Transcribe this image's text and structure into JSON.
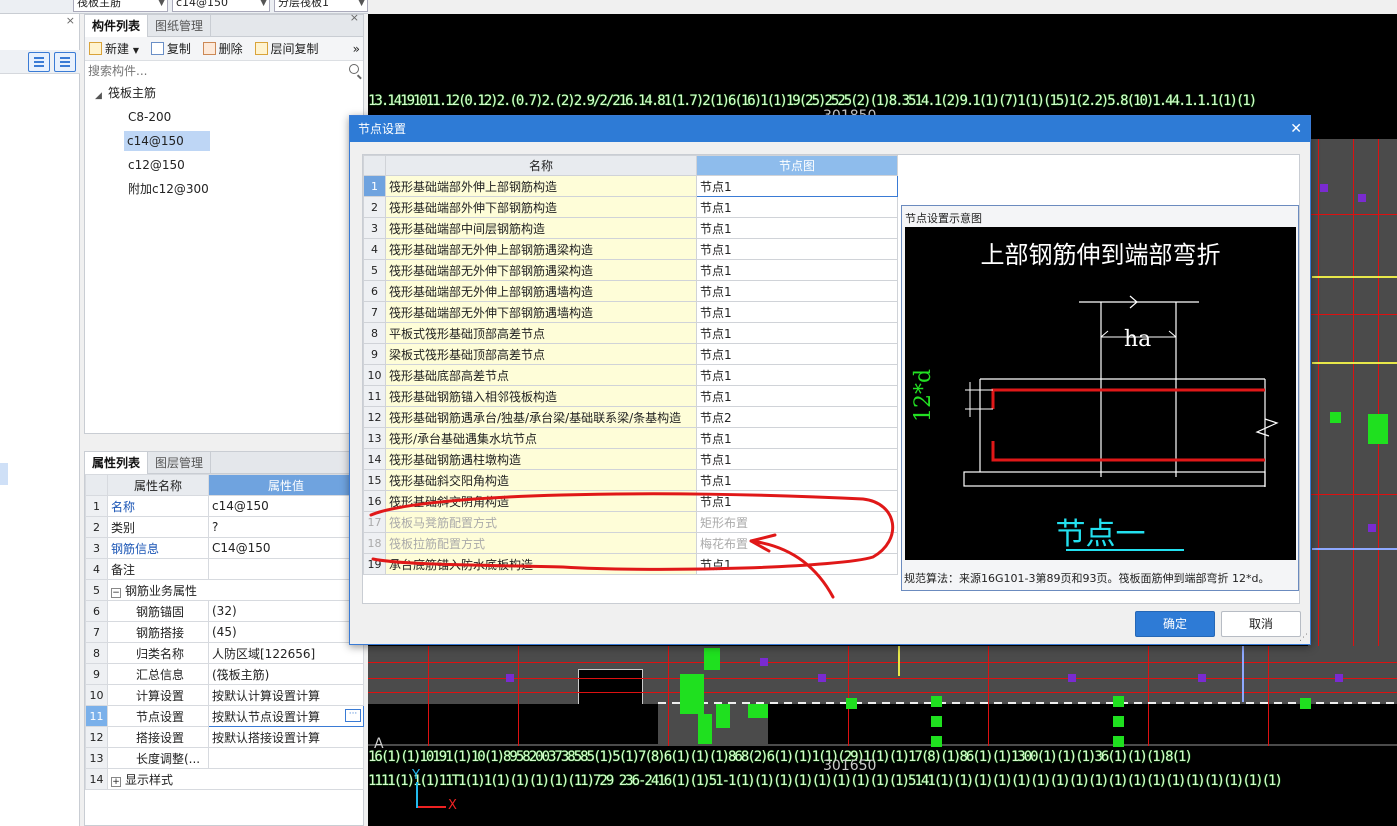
{
  "top_toolbar": {
    "combo1": "筏板主筋",
    "combo2": "c14@150",
    "combo3": "分层筏板1"
  },
  "component_panel": {
    "tabs": [
      "构件列表",
      "图纸管理"
    ],
    "toolbar": {
      "new_label": "新建",
      "copy_label": "复制",
      "delete_label": "删除",
      "floor_copy_label": "层间复制"
    },
    "search_placeholder": "搜索构件...",
    "tree": {
      "root": "筏板主筋",
      "items": [
        "C8-200",
        "c14@150",
        "c12@150",
        "附加c12@300"
      ]
    }
  },
  "property_panel": {
    "tabs": [
      "属性列表",
      "图层管理"
    ],
    "headers": {
      "name": "属性名称",
      "value": "属性值"
    },
    "rows": [
      {
        "num": "1",
        "name": "名称",
        "value": "c14@150"
      },
      {
        "num": "2",
        "name": "类别",
        "value": "?"
      },
      {
        "num": "3",
        "name": "钢筋信息",
        "value": "C14@150"
      },
      {
        "num": "4",
        "name": "备注",
        "value": ""
      },
      {
        "num": "5",
        "name": "钢筋业务属性",
        "value": ""
      },
      {
        "num": "6",
        "name": "钢筋锚固",
        "value": "(32)"
      },
      {
        "num": "7",
        "name": "钢筋搭接",
        "value": "(45)"
      },
      {
        "num": "8",
        "name": "归类名称",
        "value": "人防区域[122656]"
      },
      {
        "num": "9",
        "name": "汇总信息",
        "value": "(筏板主筋)"
      },
      {
        "num": "10",
        "name": "计算设置",
        "value": "按默认计算设置计算"
      },
      {
        "num": "11",
        "name": "节点设置",
        "value": "按默认节点设置计算"
      },
      {
        "num": "12",
        "name": "搭接设置",
        "value": "按默认搭接设置计算"
      },
      {
        "num": "13",
        "name": "长度调整(...",
        "value": ""
      },
      {
        "num": "14",
        "name": "显示样式",
        "value": ""
      }
    ],
    "expand_minus": "−",
    "expand_plus": "+"
  },
  "cad": {
    "label_top": "301850",
    "label_bottom": "301650",
    "label_a": "A",
    "axis_x": "X",
    "axis_y": "Y",
    "strip_top": "13.14191011.12(0.12)2.(0.7)2.(2)2.9/2/216.14.81(1.7)2(1)6(16)1(1)19(25)2525(2)(1)8.3514.1(2)9.1(1)(7)1(1)(15)1(2.2)5.8(10)1.44.1.1.1(1)(1)",
    "strip_bottom1": "16(1)(1)10191(1)10(1)89582003738585(1)5(1)7(8)6(1)(1)(1)868(2)6(1)(1)1(1)(29)1(1)(1)17(8)(1)86(1)(1)1300(1)(1)(1)36(1)(1)(1)8(1)",
    "strip_bottom2": "1111(1)1(1)11T1(1)1(1)(1)(1)(1)(11)729  236-2416(1)(1)51-1(1)(1)(1)(1)(1)(1)(1)(1)(1)5141(1)(1)(1)(1)(1)(1)(1)(1)(1)(1)(1)(1)(1)(1)(1)(1)(1)(1)"
  },
  "dialog": {
    "title": "节点设置",
    "headers": {
      "name": "名称",
      "node": "节点图"
    },
    "rows": [
      {
        "num": "1",
        "name": "筏形基础端部外伸上部钢筋构造",
        "node": "节点1"
      },
      {
        "num": "2",
        "name": "筏形基础端部外伸下部钢筋构造",
        "node": "节点1"
      },
      {
        "num": "3",
        "name": "筏形基础端部中间层钢筋构造",
        "node": "节点1"
      },
      {
        "num": "4",
        "name": "筏形基础端部无外伸上部钢筋遇梁构造",
        "node": "节点1"
      },
      {
        "num": "5",
        "name": "筏形基础端部无外伸下部钢筋遇梁构造",
        "node": "节点1"
      },
      {
        "num": "6",
        "name": "筏形基础端部无外伸上部钢筋遇墙构造",
        "node": "节点1"
      },
      {
        "num": "7",
        "name": "筏形基础端部无外伸下部钢筋遇墙构造",
        "node": "节点1"
      },
      {
        "num": "8",
        "name": "平板式筏形基础顶部高差节点",
        "node": "节点1"
      },
      {
        "num": "9",
        "name": "梁板式筏形基础顶部高差节点",
        "node": "节点1"
      },
      {
        "num": "10",
        "name": "筏形基础底部高差节点",
        "node": "节点1"
      },
      {
        "num": "11",
        "name": "筏形基础钢筋锚入相邻筏板构造",
        "node": "节点1"
      },
      {
        "num": "12",
        "name": "筏形基础钢筋遇承台/独基/承台梁/基础联系梁/条基构造",
        "node": "节点2"
      },
      {
        "num": "13",
        "name": "筏形/承台基础遇集水坑节点",
        "node": "节点1"
      },
      {
        "num": "14",
        "name": "筏形基础钢筋遇柱墩构造",
        "node": "节点1"
      },
      {
        "num": "15",
        "name": "筏形基础斜交阳角构造",
        "node": "节点1"
      },
      {
        "num": "16",
        "name": "筏形基础斜交阴角构造",
        "node": "节点1"
      },
      {
        "num": "17",
        "name": "筏板马凳筋配置方式",
        "node": "矩形布置"
      },
      {
        "num": "18",
        "name": "筏板拉筋配置方式",
        "node": "梅花布置"
      },
      {
        "num": "19",
        "name": "承台底筋锚入防水底板构造",
        "node": "节点1"
      }
    ],
    "preview": {
      "title": "节点设置示意图",
      "caption": "上部钢筋伸到端部弯折",
      "label_ha": "ha",
      "label_12d": "12*d",
      "node_label": "节点一",
      "note": "规范算法：来源16G101-3第89页和93页。筏板面筋伸到端部弯折 12*d。"
    },
    "ok_label": "确定",
    "cancel_label": "取消"
  },
  "colors": {
    "accent": "#2e7bd6",
    "annotation": "#e01818",
    "cad_green": "#1fe01f"
  }
}
